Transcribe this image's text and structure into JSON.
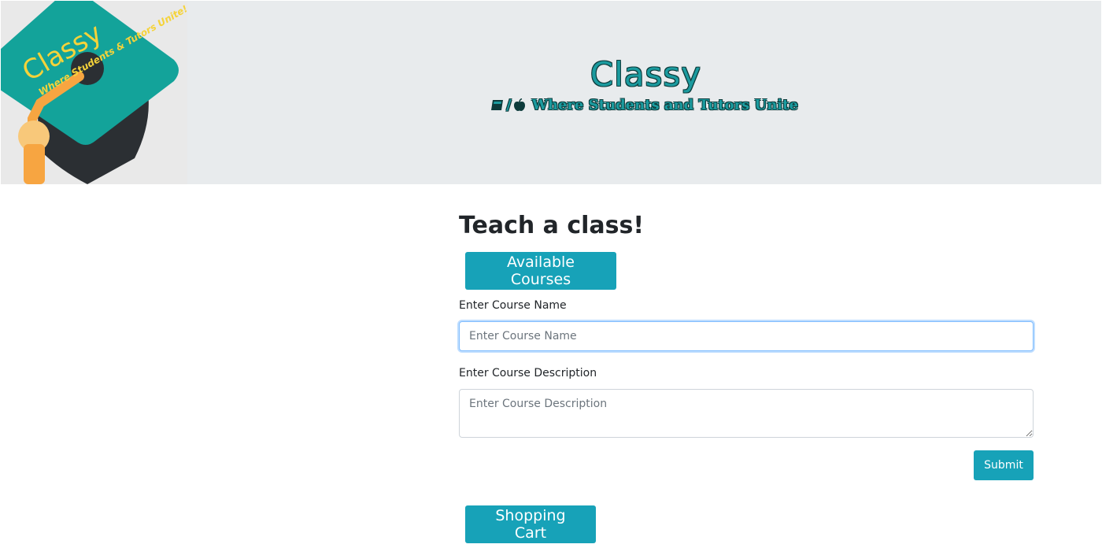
{
  "header": {
    "logo": {
      "text_main": "Classy",
      "text_sub": "Where Students & Tutors Unite!",
      "colors": {
        "cap": "#13a39a",
        "cap_dark": "#2b2f33",
        "tassel": "#f7a541",
        "text": "#f5d33a"
      }
    },
    "title": "Classy",
    "tagline": {
      "separator": "/",
      "text": "Where Students and Tutors Unite",
      "icons": [
        "book-icon",
        "apple-icon"
      ]
    },
    "colors": {
      "background": "#e8ebed",
      "title": "#1b9b9f"
    }
  },
  "main": {
    "title": "Teach a class!",
    "available_courses_label": "Available Courses",
    "course_name": {
      "label": "Enter Course Name",
      "placeholder": "Enter Course Name",
      "value": ""
    },
    "course_description": {
      "label": "Enter Course Description",
      "placeholder": "Enter Course Description",
      "value": ""
    },
    "submit_label": "Submit",
    "shopping_cart_label": "Shopping Cart"
  },
  "colors": {
    "primary_button": "#17a2b8"
  }
}
